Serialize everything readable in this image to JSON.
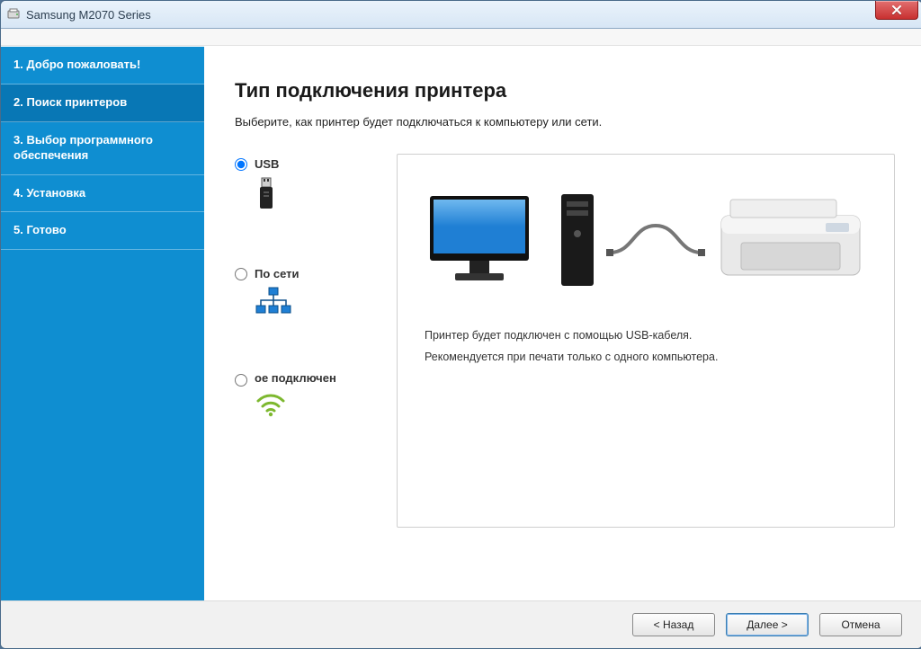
{
  "window": {
    "title": "Samsung M2070 Series"
  },
  "sidebar": {
    "steps": [
      "1. Добро пожаловать!",
      "2. Поиск принтеров",
      "3. Выбор программного обеспечения",
      "4. Установка",
      "5. Готово"
    ],
    "active_index": 1
  },
  "page": {
    "title": "Тип подключения принтера",
    "subtitle": "Выберите, как принтер будет подключаться к компьютеру или сети."
  },
  "options": {
    "usb": {
      "label": "USB",
      "selected": true
    },
    "network": {
      "label": "По сети",
      "selected": false
    },
    "wireless": {
      "label": "ое подключен",
      "selected": false
    }
  },
  "info": {
    "line1": "Принтер будет подключен с помощью USB-кабеля.",
    "line2": "Рекомендуется при печати только с одного компьютера."
  },
  "footer": {
    "back": "< Назад",
    "next": "Далее >",
    "cancel": "Отмена"
  },
  "colors": {
    "sidebar": "#0f8ed1",
    "sidebar_active": "#0877b5",
    "close_red": "#c83030",
    "monitor_blue": "#1f7fd4"
  }
}
